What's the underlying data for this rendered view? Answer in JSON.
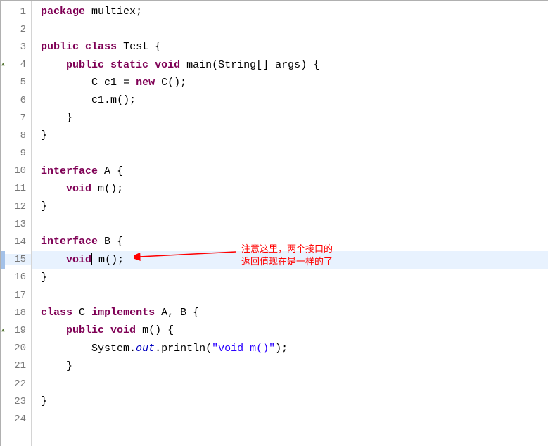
{
  "lines": [
    {
      "n": "1",
      "mark": "",
      "seg": [
        " ",
        "kw:package",
        " ",
        "plain:multiex",
        ";"
      ]
    },
    {
      "n": "2",
      "mark": "",
      "seg": [
        " "
      ]
    },
    {
      "n": "3",
      "mark": "",
      "seg": [
        " ",
        "kw:public",
        " ",
        "kw:class",
        " ",
        "type:Test",
        " {"
      ]
    },
    {
      "n": "4",
      "mark": "override",
      "seg": [
        "     ",
        "kw:public",
        " ",
        "kw:static",
        " ",
        "kw:void",
        " ",
        "plain:main",
        "(",
        "type:String",
        "[] ",
        "plain:args",
        ") {"
      ]
    },
    {
      "n": "5",
      "mark": "",
      "seg": [
        "         ",
        "type:C",
        " ",
        "plain:c1",
        " = ",
        "kw:new",
        " ",
        "type:C",
        "();"
      ]
    },
    {
      "n": "6",
      "mark": "",
      "seg": [
        "         ",
        "plain:c1",
        ".",
        "plain:m",
        "();"
      ]
    },
    {
      "n": "7",
      "mark": "",
      "seg": [
        "     }"
      ]
    },
    {
      "n": "8",
      "mark": "",
      "seg": [
        " }"
      ]
    },
    {
      "n": "9",
      "mark": "",
      "seg": [
        " "
      ]
    },
    {
      "n": "10",
      "mark": "",
      "seg": [
        " ",
        "kw:interface",
        " ",
        "type:A",
        " {"
      ]
    },
    {
      "n": "11",
      "mark": "",
      "seg": [
        "     ",
        "kw:void",
        " ",
        "plain:m",
        "();"
      ]
    },
    {
      "n": "12",
      "mark": "",
      "seg": [
        " }"
      ]
    },
    {
      "n": "13",
      "mark": "",
      "seg": [
        " "
      ]
    },
    {
      "n": "14",
      "mark": "",
      "seg": [
        " ",
        "kw:interface",
        " ",
        "type:B",
        " {"
      ]
    },
    {
      "n": "15",
      "mark": "current",
      "seg": [
        "     ",
        "kw:void",
        "CURSOR",
        " ",
        "plain:m",
        "();"
      ]
    },
    {
      "n": "16",
      "mark": "",
      "seg": [
        " }"
      ]
    },
    {
      "n": "17",
      "mark": "",
      "seg": [
        " "
      ]
    },
    {
      "n": "18",
      "mark": "",
      "seg": [
        " ",
        "kw:class",
        " ",
        "type:C",
        " ",
        "kw:implements",
        " ",
        "type:A",
        ", ",
        "type:B",
        " {"
      ]
    },
    {
      "n": "19",
      "mark": "override",
      "seg": [
        "     ",
        "kw:public",
        " ",
        "kw:void",
        " ",
        "plain:m",
        "() {"
      ]
    },
    {
      "n": "20",
      "mark": "",
      "seg": [
        "         ",
        "type:System",
        ".",
        "static-field:out",
        ".",
        "plain:println",
        "(",
        "str:\"void m()\"",
        ");"
      ]
    },
    {
      "n": "21",
      "mark": "",
      "seg": [
        "     }"
      ]
    },
    {
      "n": "22",
      "mark": "",
      "seg": [
        " "
      ]
    },
    {
      "n": "23",
      "mark": "",
      "seg": [
        " }"
      ]
    },
    {
      "n": "24",
      "mark": "",
      "seg": [
        " "
      ]
    }
  ],
  "annotation": {
    "line1": "注意这里，两个接口的",
    "line2": "返回值现在是一样的了"
  }
}
